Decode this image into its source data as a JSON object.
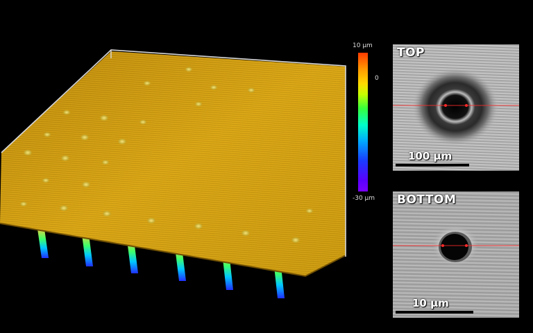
{
  "colorbar": {
    "max_label": "10 µm",
    "zero_label": "0",
    "min_label": "-30 µm"
  },
  "top_panel": {
    "title": "TOP",
    "scale_label": "100 µm"
  },
  "bottom_panel": {
    "title": "BOTTOM",
    "scale_label": "10 µm"
  },
  "colors": {
    "surface": "#c99a12",
    "measure_line": "#ff2a2a",
    "background": "#000000"
  }
}
